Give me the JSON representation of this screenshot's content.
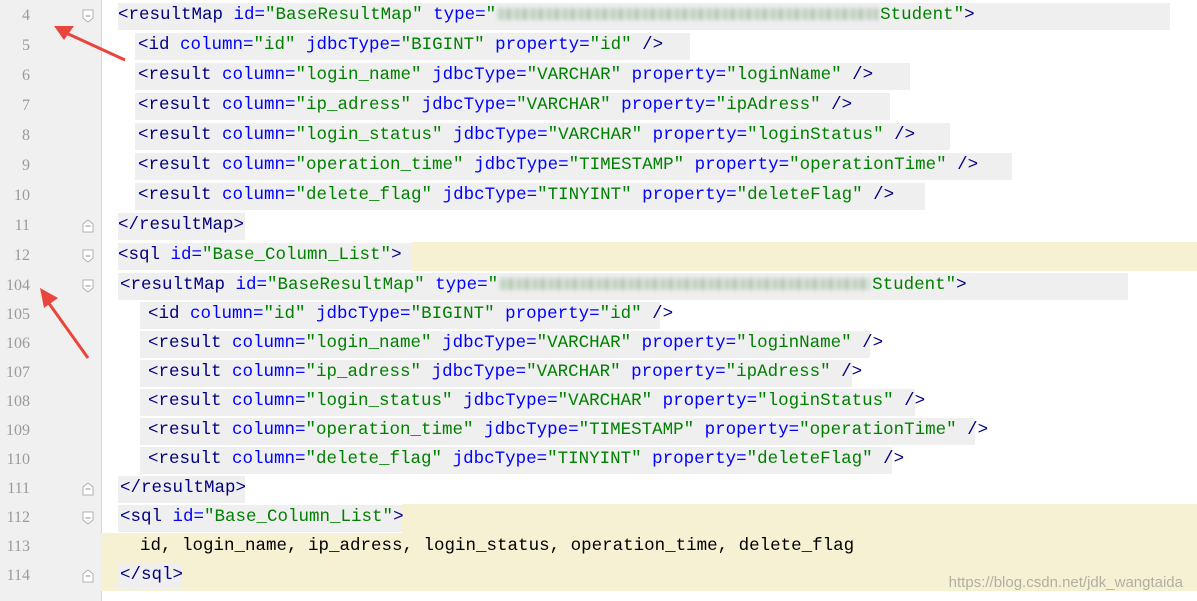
{
  "lines": [
    {
      "num": "4",
      "fold": "open",
      "hl": [
        118,
        1170
      ],
      "yellow": null,
      "indent": 118,
      "tokens": [
        [
          "tag",
          "<resultMap "
        ],
        [
          "attr",
          "id="
        ],
        [
          "val",
          "\"BaseResultMap\" "
        ],
        [
          "attr",
          "type="
        ],
        [
          "val",
          "\""
        ],
        [
          "blur",
          "380"
        ],
        [
          "val",
          "Student\""
        ],
        [
          "tag",
          ">"
        ]
      ]
    },
    {
      "num": "5",
      "fold": "",
      "hl": [
        135,
        690
      ],
      "yellow": null,
      "indent": 138,
      "tokens": [
        [
          "tag",
          "<id "
        ],
        [
          "attr",
          "column="
        ],
        [
          "val",
          "\"id\" "
        ],
        [
          "attr",
          "jdbcType="
        ],
        [
          "val",
          "\"BIGINT\" "
        ],
        [
          "attr",
          "property="
        ],
        [
          "val",
          "\"id\" "
        ],
        [
          "tag",
          "/>"
        ]
      ]
    },
    {
      "num": "6",
      "fold": "",
      "hl": [
        135,
        910
      ],
      "yellow": null,
      "indent": 138,
      "tokens": [
        [
          "tag",
          "<result "
        ],
        [
          "attr",
          "column="
        ],
        [
          "val",
          "\"login_name\" "
        ],
        [
          "attr",
          "jdbcType="
        ],
        [
          "val",
          "\"VARCHAR\" "
        ],
        [
          "attr",
          "property="
        ],
        [
          "val",
          "\"loginName\" "
        ],
        [
          "tag",
          "/>"
        ]
      ]
    },
    {
      "num": "7",
      "fold": "",
      "hl": [
        135,
        890
      ],
      "yellow": null,
      "indent": 138,
      "tokens": [
        [
          "tag",
          "<result "
        ],
        [
          "attr",
          "column="
        ],
        [
          "val",
          "\"ip_adress\" "
        ],
        [
          "attr",
          "jdbcType="
        ],
        [
          "val",
          "\"VARCHAR\" "
        ],
        [
          "attr",
          "property="
        ],
        [
          "val",
          "\"ipAdress\" "
        ],
        [
          "tag",
          "/>"
        ]
      ]
    },
    {
      "num": "8",
      "fold": "",
      "hl": [
        135,
        950
      ],
      "yellow": null,
      "indent": 138,
      "tokens": [
        [
          "tag",
          "<result "
        ],
        [
          "attr",
          "column="
        ],
        [
          "val",
          "\"login_status\" "
        ],
        [
          "attr",
          "jdbcType="
        ],
        [
          "val",
          "\"VARCHAR\" "
        ],
        [
          "attr",
          "property="
        ],
        [
          "val",
          "\"loginStatus\" "
        ],
        [
          "tag",
          "/>"
        ]
      ]
    },
    {
      "num": "9",
      "fold": "",
      "hl": [
        135,
        1012
      ],
      "yellow": null,
      "indent": 138,
      "tokens": [
        [
          "tag",
          "<result "
        ],
        [
          "attr",
          "column="
        ],
        [
          "val",
          "\"operation_time\" "
        ],
        [
          "attr",
          "jdbcType="
        ],
        [
          "val",
          "\"TIMESTAMP\" "
        ],
        [
          "attr",
          "property="
        ],
        [
          "val",
          "\"operationTime\" "
        ],
        [
          "tag",
          "/>"
        ]
      ]
    },
    {
      "num": "10",
      "fold": "",
      "hl": [
        135,
        925
      ],
      "yellow": null,
      "indent": 138,
      "tokens": [
        [
          "tag",
          "<result "
        ],
        [
          "attr",
          "column="
        ],
        [
          "val",
          "\"delete_flag\" "
        ],
        [
          "attr",
          "jdbcType="
        ],
        [
          "val",
          "\"TINYINT\" "
        ],
        [
          "attr",
          "property="
        ],
        [
          "val",
          "\"deleteFlag\" "
        ],
        [
          "tag",
          "/>"
        ]
      ]
    },
    {
      "num": "11",
      "fold": "close",
      "hl": [
        118,
        245
      ],
      "yellow": null,
      "indent": 118,
      "tokens": [
        [
          "tag",
          "</resultMap>"
        ]
      ]
    },
    {
      "num": "12",
      "fold": "open",
      "hl": [
        118,
        412
      ],
      "yellow": [
        412,
        1197
      ],
      "indent": 118,
      "tokens": [
        [
          "tag",
          "<sql "
        ],
        [
          "attr",
          "id="
        ],
        [
          "val",
          "\"Base_Column_List\""
        ],
        [
          "tag",
          ">"
        ]
      ]
    },
    {
      "num": "104",
      "fold": "open",
      "hl": [
        118,
        1128
      ],
      "yellow": null,
      "indent": 120,
      "tokens": [
        [
          "tag",
          "<resultMap "
        ],
        [
          "attr",
          "id="
        ],
        [
          "val",
          "\"BaseResultMap\" "
        ],
        [
          "attr",
          "type="
        ],
        [
          "val",
          "\""
        ],
        [
          "blur",
          "370"
        ],
        [
          "val",
          "Student\""
        ],
        [
          "tag",
          ">"
        ]
      ]
    },
    {
      "num": "105",
      "fold": "",
      "hl": [
        140,
        660
      ],
      "yellow": null,
      "indent": 148,
      "tokens": [
        [
          "tag",
          "<id "
        ],
        [
          "attr",
          "column="
        ],
        [
          "val",
          "\"id\" "
        ],
        [
          "attr",
          "jdbcType="
        ],
        [
          "val",
          "\"BIGINT\" "
        ],
        [
          "attr",
          "property="
        ],
        [
          "val",
          "\"id\" "
        ],
        [
          "tag",
          "/>"
        ]
      ]
    },
    {
      "num": "106",
      "fold": "",
      "hl": [
        140,
        870
      ],
      "yellow": null,
      "indent": 148,
      "tokens": [
        [
          "tag",
          "<result "
        ],
        [
          "attr",
          "column="
        ],
        [
          "val",
          "\"login_name\" "
        ],
        [
          "attr",
          "jdbcType="
        ],
        [
          "val",
          "\"VARCHAR\" "
        ],
        [
          "attr",
          "property="
        ],
        [
          "val",
          "\"loginName\" "
        ],
        [
          "tag",
          "/>"
        ]
      ]
    },
    {
      "num": "107",
      "fold": "",
      "hl": [
        140,
        852
      ],
      "yellow": null,
      "indent": 148,
      "tokens": [
        [
          "tag",
          "<result "
        ],
        [
          "attr",
          "column="
        ],
        [
          "val",
          "\"ip_adress\" "
        ],
        [
          "attr",
          "jdbcType="
        ],
        [
          "val",
          "\"VARCHAR\" "
        ],
        [
          "attr",
          "property="
        ],
        [
          "val",
          "\"ipAdress\" "
        ],
        [
          "tag",
          "/>"
        ]
      ]
    },
    {
      "num": "108",
      "fold": "",
      "hl": [
        140,
        915
      ],
      "yellow": null,
      "indent": 148,
      "tokens": [
        [
          "tag",
          "<result "
        ],
        [
          "attr",
          "column="
        ],
        [
          "val",
          "\"login_status\" "
        ],
        [
          "attr",
          "jdbcType="
        ],
        [
          "val",
          "\"VARCHAR\" "
        ],
        [
          "attr",
          "property="
        ],
        [
          "val",
          "\"loginStatus\" "
        ],
        [
          "tag",
          "/>"
        ]
      ]
    },
    {
      "num": "109",
      "fold": "",
      "hl": [
        140,
        975
      ],
      "yellow": null,
      "indent": 148,
      "tokens": [
        [
          "tag",
          "<result "
        ],
        [
          "attr",
          "column="
        ],
        [
          "val",
          "\"operation_time\" "
        ],
        [
          "attr",
          "jdbcType="
        ],
        [
          "val",
          "\"TIMESTAMP\" "
        ],
        [
          "attr",
          "property="
        ],
        [
          "val",
          "\"operationTime\" "
        ],
        [
          "tag",
          "/>"
        ]
      ]
    },
    {
      "num": "110",
      "fold": "",
      "hl": [
        140,
        892
      ],
      "yellow": null,
      "indent": 148,
      "tokens": [
        [
          "tag",
          "<result "
        ],
        [
          "attr",
          "column="
        ],
        [
          "val",
          "\"delete_flag\" "
        ],
        [
          "attr",
          "jdbcType="
        ],
        [
          "val",
          "\"TINYINT\" "
        ],
        [
          "attr",
          "property="
        ],
        [
          "val",
          "\"deleteFlag\" "
        ],
        [
          "tag",
          "/>"
        ]
      ]
    },
    {
      "num": "111",
      "fold": "close",
      "hl": [
        118,
        245
      ],
      "yellow": null,
      "indent": 120,
      "tokens": [
        [
          "tag",
          "</resultMap>"
        ]
      ]
    },
    {
      "num": "112",
      "fold": "open",
      "hl": [
        118,
        402
      ],
      "yellow": [
        402,
        1197
      ],
      "indent": 120,
      "tokens": [
        [
          "tag",
          "<sql "
        ],
        [
          "attr",
          "id="
        ],
        [
          "val",
          "\"Base_Column_List\""
        ],
        [
          "tag",
          ">"
        ]
      ]
    },
    {
      "num": "113",
      "fold": "",
      "hl": null,
      "yellow": [
        101,
        1197
      ],
      "indent": 140,
      "tokens": [
        [
          "txt",
          "id, login_name, ip_adress, login_status, operation_time, delete_flag"
        ]
      ]
    },
    {
      "num": "114",
      "fold": "close",
      "hl": [
        118,
        182
      ],
      "yellow": [
        101,
        1197
      ],
      "indent": 120,
      "tokens": [
        [
          "tag",
          "</sql>"
        ]
      ]
    }
  ],
  "watermark": "https://blog.csdn.net/jdk_wangtaida",
  "colors": {
    "tag": "#000080",
    "attr": "#0000ff",
    "val": "#008000",
    "yellow": "#f7f1d3",
    "gutter": "#f0f0f0",
    "arrow": "#e8453c"
  },
  "icons": [
    "fold-open-icon",
    "fold-close-icon",
    "red-arrow-annotation"
  ]
}
